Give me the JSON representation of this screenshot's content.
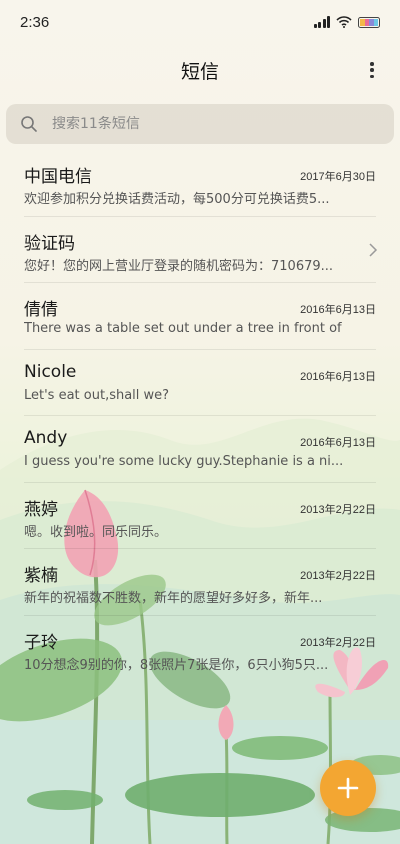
{
  "status_bar": {
    "time": "2:36"
  },
  "header": {
    "title": "短信"
  },
  "search": {
    "placeholder": "搜索11条短信"
  },
  "conversations": [
    {
      "name": "中国电信",
      "date": "2017年6月30日",
      "preview": "欢迎参加积分兑换话费活动，每500分可兑换话费5...",
      "has_chevron": false
    },
    {
      "name": "验证码",
      "date": "",
      "preview": "您好！您的网上营业厅登录的随机密码为：710679...",
      "has_chevron": true
    },
    {
      "name": "倩倩",
      "date": "2016年6月13日",
      "preview": "There was a table set out under a tree in front of ...",
      "has_chevron": false
    },
    {
      "name": "Nicole",
      "date": "2016年6月13日",
      "preview": "Let's eat out,shall we?",
      "has_chevron": false
    },
    {
      "name": "Andy",
      "date": "2016年6月13日",
      "preview": "I guess you're some lucky guy.Stephanie is a ni...",
      "has_chevron": false
    },
    {
      "name": "燕婷",
      "date": "2013年2月22日",
      "preview": "嗯。收到啦。同乐同乐。",
      "has_chevron": false
    },
    {
      "name": "紫楠",
      "date": "2013年2月22日",
      "preview": "新年的祝福数不胜数，新年的愿望好多好多，新年...",
      "has_chevron": false
    },
    {
      "name": "子玲",
      "date": "2013年2月22日",
      "preview": "10分想念9别的你，8张照片7张是你，6只小狗5只...",
      "has_chevron": false
    }
  ],
  "icons": {
    "search": "search-icon",
    "more": "more-vertical-icon",
    "chevron": "chevron-right-icon",
    "compose": "plus-icon",
    "wifi": "wifi-icon",
    "signal": "signal-icon",
    "battery": "battery-icon"
  },
  "colors": {
    "accent": "#f3a632",
    "battery_bars": [
      "#f3b84a",
      "#e86a9a",
      "#8a8ad8",
      "#6ec8e6"
    ]
  }
}
